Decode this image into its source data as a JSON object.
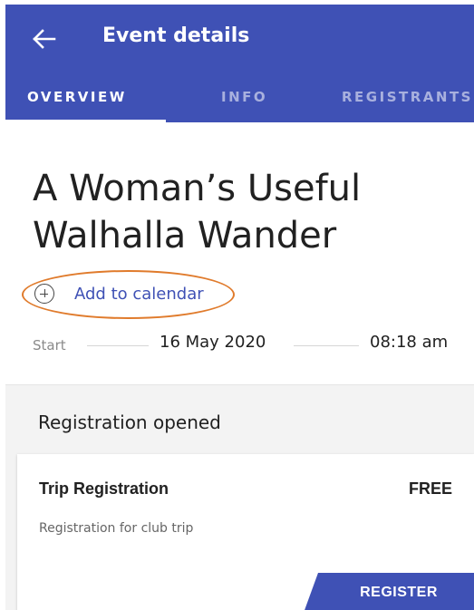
{
  "appbar": {
    "title": "Event details",
    "back_icon": "arrow-left-icon",
    "background_color": "#3f51b5"
  },
  "tabs": [
    {
      "label": "OVERVIEW",
      "active": true
    },
    {
      "label": "INFO",
      "active": false
    },
    {
      "label": "REGISTRANTS",
      "active": false
    }
  ],
  "event": {
    "title": "A Woman’s Useful Walhalla Wander",
    "add_to_calendar": "Add to calendar",
    "add_icon": "plus-circle-icon",
    "start_label": "Start",
    "start_date": "16 May 2020",
    "start_time": "08:18 am"
  },
  "registration": {
    "status": "Registration opened",
    "card": {
      "title": "Trip Registration",
      "price": "FREE",
      "description": "Registration for club trip",
      "button": "REGISTER"
    }
  },
  "annotation_color": "#e07b2c"
}
